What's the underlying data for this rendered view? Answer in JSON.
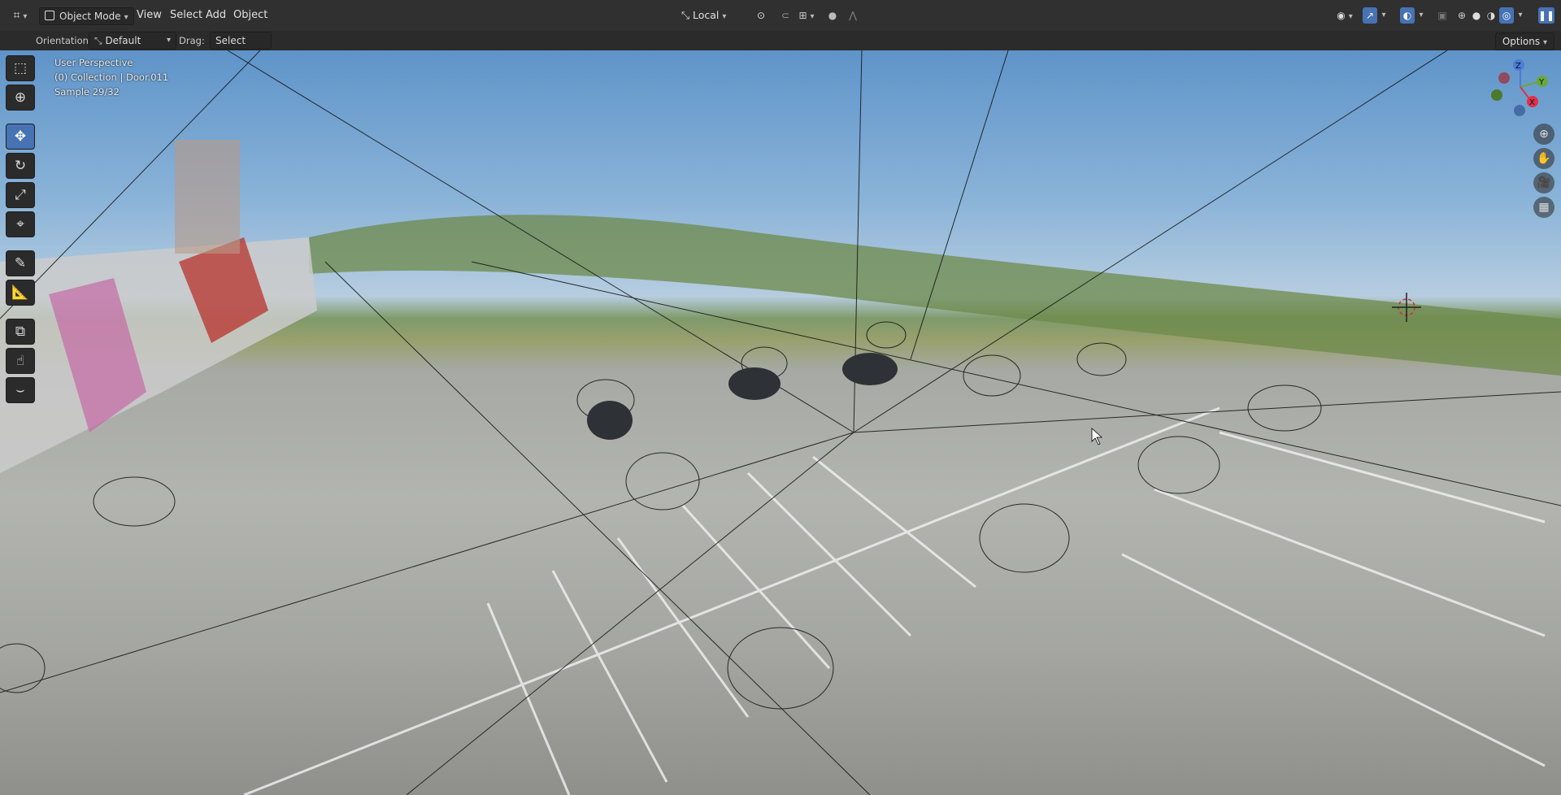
{
  "header": {
    "editor_type_icon": "editor-type-icon",
    "mode_label": "Object Mode",
    "menus": [
      "View",
      "Select",
      "Add",
      "Object"
    ],
    "pivot_label": "Local",
    "colors": {
      "header_bg": "#303030",
      "accent": "#4772b3"
    }
  },
  "tool_settings": {
    "orientation_label": "Orientation:",
    "orientation_value": "Default",
    "drag_label": "Drag:",
    "drag_value": "Select Box",
    "options_label": "Options"
  },
  "viewport": {
    "info": {
      "view": "User Perspective",
      "collection": "(0) Collection | Door.011",
      "sample": "Sample 29/32"
    },
    "gizmo_axes": [
      "Z",
      "Y",
      "X"
    ]
  },
  "toolbar": {
    "tools": [
      "select-box-icon",
      "cursor-icon",
      "move-icon",
      "rotate-icon",
      "scale-icon",
      "transform-icon",
      "annotate-icon",
      "measure-icon",
      "add-cube-icon",
      "paint-icon",
      "curve-icon"
    ]
  }
}
